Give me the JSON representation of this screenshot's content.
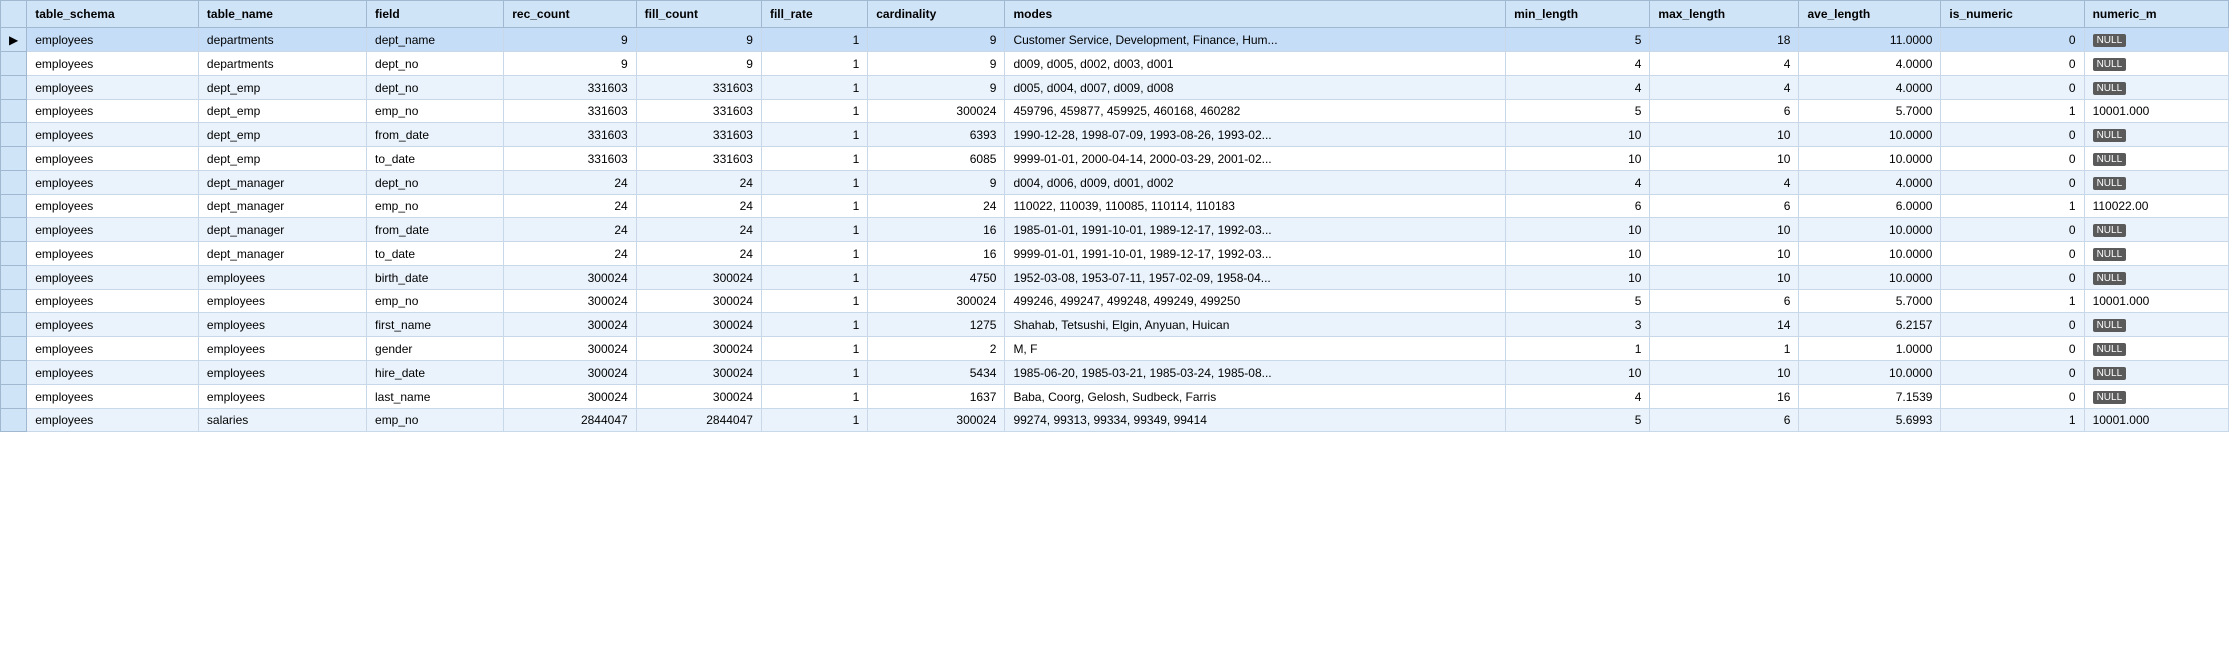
{
  "table": {
    "columns": [
      {
        "key": "indicator",
        "label": ""
      },
      {
        "key": "table_schema",
        "label": "table_schema"
      },
      {
        "key": "table_name",
        "label": "table_name"
      },
      {
        "key": "field",
        "label": "field"
      },
      {
        "key": "rec_count",
        "label": "rec_count"
      },
      {
        "key": "fill_count",
        "label": "fill_count"
      },
      {
        "key": "fill_rate",
        "label": "fill_rate"
      },
      {
        "key": "cardinality",
        "label": "cardinality"
      },
      {
        "key": "modes",
        "label": "modes"
      },
      {
        "key": "min_length",
        "label": "min_length"
      },
      {
        "key": "max_length",
        "label": "max_length"
      },
      {
        "key": "ave_length",
        "label": "ave_length"
      },
      {
        "key": "is_numeric",
        "label": "is_numeric"
      },
      {
        "key": "numeric_m",
        "label": "numeric_m"
      }
    ],
    "rows": [
      {
        "indicator": "▶",
        "table_schema": "employees",
        "table_name": "departments",
        "field": "dept_name",
        "rec_count": "9",
        "fill_count": "9",
        "fill_rate": "1",
        "cardinality": "9",
        "modes": "Customer Service, Development, Finance, Hum...",
        "min_length": "5",
        "max_length": "18",
        "ave_length": "11.0000",
        "is_numeric": "0",
        "numeric_m": "NULL",
        "selected": true
      },
      {
        "indicator": "",
        "table_schema": "employees",
        "table_name": "departments",
        "field": "dept_no",
        "rec_count": "9",
        "fill_count": "9",
        "fill_rate": "1",
        "cardinality": "9",
        "modes": "d009, d005, d002, d003, d001",
        "min_length": "4",
        "max_length": "4",
        "ave_length": "4.0000",
        "is_numeric": "0",
        "numeric_m": "NULL",
        "selected": false
      },
      {
        "indicator": "",
        "table_schema": "employees",
        "table_name": "dept_emp",
        "field": "dept_no",
        "rec_count": "331603",
        "fill_count": "331603",
        "fill_rate": "1",
        "cardinality": "9",
        "modes": "d005, d004, d007, d009, d008",
        "min_length": "4",
        "max_length": "4",
        "ave_length": "4.0000",
        "is_numeric": "0",
        "numeric_m": "NULL",
        "selected": false
      },
      {
        "indicator": "",
        "table_schema": "employees",
        "table_name": "dept_emp",
        "field": "emp_no",
        "rec_count": "331603",
        "fill_count": "331603",
        "fill_rate": "1",
        "cardinality": "300024",
        "modes": "459796, 459877, 459925, 460168, 460282",
        "min_length": "5",
        "max_length": "6",
        "ave_length": "5.7000",
        "is_numeric": "1",
        "numeric_m": "10001.000",
        "selected": false
      },
      {
        "indicator": "",
        "table_schema": "employees",
        "table_name": "dept_emp",
        "field": "from_date",
        "rec_count": "331603",
        "fill_count": "331603",
        "fill_rate": "1",
        "cardinality": "6393",
        "modes": "1990-12-28, 1998-07-09, 1993-08-26, 1993-02...",
        "min_length": "10",
        "max_length": "10",
        "ave_length": "10.0000",
        "is_numeric": "0",
        "numeric_m": "NULL",
        "selected": false
      },
      {
        "indicator": "",
        "table_schema": "employees",
        "table_name": "dept_emp",
        "field": "to_date",
        "rec_count": "331603",
        "fill_count": "331603",
        "fill_rate": "1",
        "cardinality": "6085",
        "modes": "9999-01-01, 2000-04-14, 2000-03-29, 2001-02...",
        "min_length": "10",
        "max_length": "10",
        "ave_length": "10.0000",
        "is_numeric": "0",
        "numeric_m": "NULL",
        "selected": false
      },
      {
        "indicator": "",
        "table_schema": "employees",
        "table_name": "dept_manager",
        "field": "dept_no",
        "rec_count": "24",
        "fill_count": "24",
        "fill_rate": "1",
        "cardinality": "9",
        "modes": "d004, d006, d009, d001, d002",
        "min_length": "4",
        "max_length": "4",
        "ave_length": "4.0000",
        "is_numeric": "0",
        "numeric_m": "NULL",
        "selected": false
      },
      {
        "indicator": "",
        "table_schema": "employees",
        "table_name": "dept_manager",
        "field": "emp_no",
        "rec_count": "24",
        "fill_count": "24",
        "fill_rate": "1",
        "cardinality": "24",
        "modes": "110022, 110039, 110085, 110114, 110183",
        "min_length": "6",
        "max_length": "6",
        "ave_length": "6.0000",
        "is_numeric": "1",
        "numeric_m": "110022.00",
        "selected": false
      },
      {
        "indicator": "",
        "table_schema": "employees",
        "table_name": "dept_manager",
        "field": "from_date",
        "rec_count": "24",
        "fill_count": "24",
        "fill_rate": "1",
        "cardinality": "16",
        "modes": "1985-01-01, 1991-10-01, 1989-12-17, 1992-03...",
        "min_length": "10",
        "max_length": "10",
        "ave_length": "10.0000",
        "is_numeric": "0",
        "numeric_m": "NULL",
        "selected": false
      },
      {
        "indicator": "",
        "table_schema": "employees",
        "table_name": "dept_manager",
        "field": "to_date",
        "rec_count": "24",
        "fill_count": "24",
        "fill_rate": "1",
        "cardinality": "16",
        "modes": "9999-01-01, 1991-10-01, 1989-12-17, 1992-03...",
        "min_length": "10",
        "max_length": "10",
        "ave_length": "10.0000",
        "is_numeric": "0",
        "numeric_m": "NULL",
        "selected": false
      },
      {
        "indicator": "",
        "table_schema": "employees",
        "table_name": "employees",
        "field": "birth_date",
        "rec_count": "300024",
        "fill_count": "300024",
        "fill_rate": "1",
        "cardinality": "4750",
        "modes": "1952-03-08, 1953-07-11, 1957-02-09, 1958-04...",
        "min_length": "10",
        "max_length": "10",
        "ave_length": "10.0000",
        "is_numeric": "0",
        "numeric_m": "NULL",
        "selected": false
      },
      {
        "indicator": "",
        "table_schema": "employees",
        "table_name": "employees",
        "field": "emp_no",
        "rec_count": "300024",
        "fill_count": "300024",
        "fill_rate": "1",
        "cardinality": "300024",
        "modes": "499246, 499247, 499248, 499249, 499250",
        "min_length": "5",
        "max_length": "6",
        "ave_length": "5.7000",
        "is_numeric": "1",
        "numeric_m": "10001.000",
        "selected": false
      },
      {
        "indicator": "",
        "table_schema": "employees",
        "table_name": "employees",
        "field": "first_name",
        "rec_count": "300024",
        "fill_count": "300024",
        "fill_rate": "1",
        "cardinality": "1275",
        "modes": "Shahab, Tetsushi, Elgin, Anyuan, Huican",
        "min_length": "3",
        "max_length": "14",
        "ave_length": "6.2157",
        "is_numeric": "0",
        "numeric_m": "NULL",
        "selected": false
      },
      {
        "indicator": "",
        "table_schema": "employees",
        "table_name": "employees",
        "field": "gender",
        "rec_count": "300024",
        "fill_count": "300024",
        "fill_rate": "1",
        "cardinality": "2",
        "modes": "M, F",
        "min_length": "1",
        "max_length": "1",
        "ave_length": "1.0000",
        "is_numeric": "0",
        "numeric_m": "NULL",
        "selected": false
      },
      {
        "indicator": "",
        "table_schema": "employees",
        "table_name": "employees",
        "field": "hire_date",
        "rec_count": "300024",
        "fill_count": "300024",
        "fill_rate": "1",
        "cardinality": "5434",
        "modes": "1985-06-20, 1985-03-21, 1985-03-24, 1985-08...",
        "min_length": "10",
        "max_length": "10",
        "ave_length": "10.0000",
        "is_numeric": "0",
        "numeric_m": "NULL",
        "selected": false
      },
      {
        "indicator": "",
        "table_schema": "employees",
        "table_name": "employees",
        "field": "last_name",
        "rec_count": "300024",
        "fill_count": "300024",
        "fill_rate": "1",
        "cardinality": "1637",
        "modes": "Baba, Coorg, Gelosh, Sudbeck, Farris",
        "min_length": "4",
        "max_length": "16",
        "ave_length": "7.1539",
        "is_numeric": "0",
        "numeric_m": "NULL",
        "selected": false
      },
      {
        "indicator": "",
        "table_schema": "employees",
        "table_name": "salaries",
        "field": "emp_no",
        "rec_count": "2844047",
        "fill_count": "2844047",
        "fill_rate": "1",
        "cardinality": "300024",
        "modes": "99274, 99313, 99334, 99349, 99414",
        "min_length": "5",
        "max_length": "6",
        "ave_length": "5.6993",
        "is_numeric": "1",
        "numeric_m": "10001.000",
        "selected": false
      }
    ]
  }
}
